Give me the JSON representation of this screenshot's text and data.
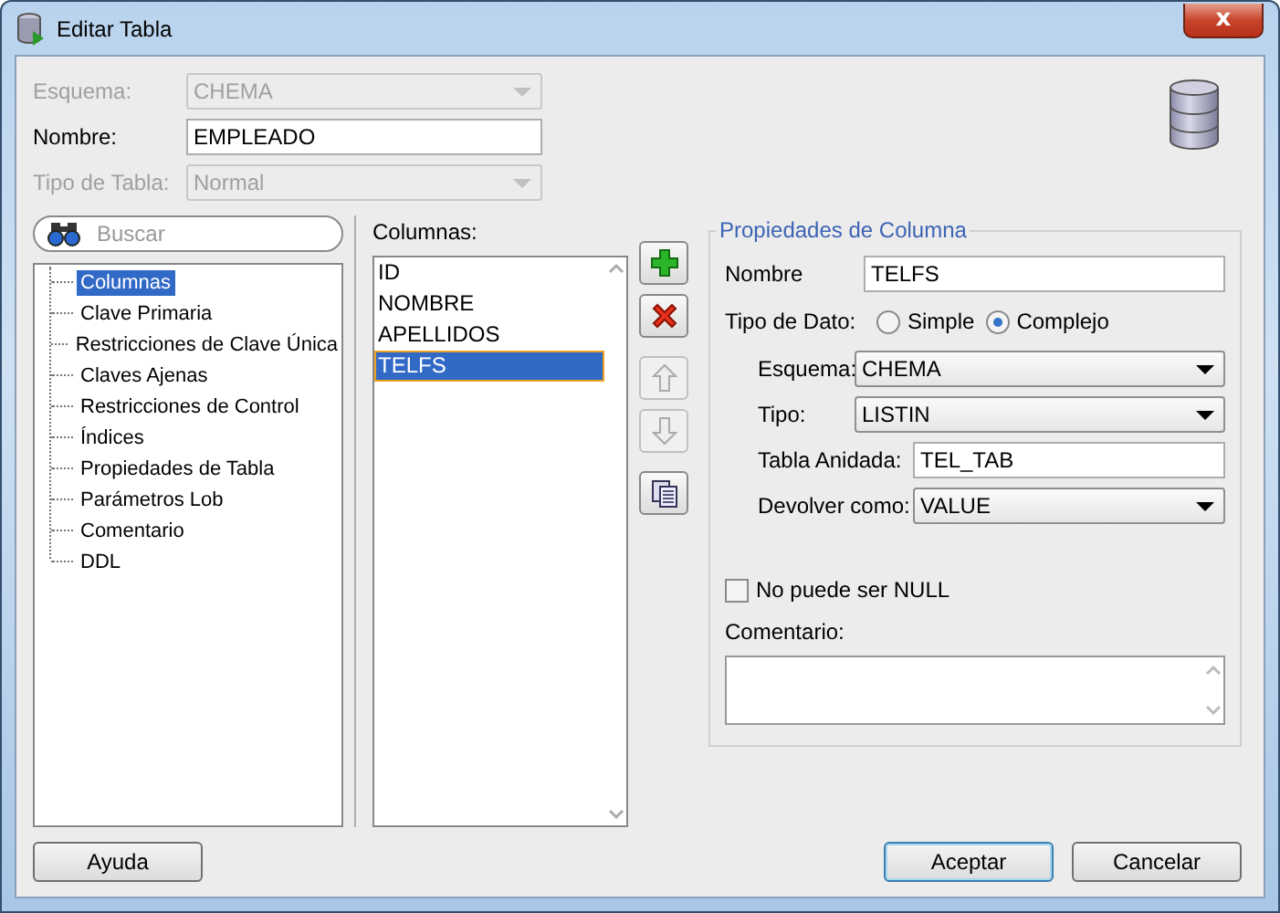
{
  "window": {
    "title": "Editar Tabla",
    "close": "x"
  },
  "header_fields": [
    {
      "label": "Esquema:",
      "kind": "select",
      "value": "CHEMA",
      "disabled": true
    },
    {
      "label": "Nombre:",
      "kind": "text",
      "value": "EMPLEADO",
      "disabled": false
    },
    {
      "label": "Tipo de Tabla:",
      "kind": "select",
      "value": "Normal",
      "disabled": true
    }
  ],
  "search": {
    "placeholder": "Buscar"
  },
  "tree": {
    "items": [
      {
        "label": "Columnas",
        "selected": true
      },
      {
        "label": "Clave Primaria",
        "selected": false
      },
      {
        "label": "Restricciones de Clave Única",
        "selected": false
      },
      {
        "label": "Claves Ajenas",
        "selected": false
      },
      {
        "label": "Restricciones de Control",
        "selected": false
      },
      {
        "label": "Índices",
        "selected": false
      },
      {
        "label": "Propiedades de Tabla",
        "selected": false
      },
      {
        "label": "Parámetros Lob",
        "selected": false
      },
      {
        "label": "Comentario",
        "selected": false
      },
      {
        "label": "DDL",
        "selected": false
      }
    ]
  },
  "columns": {
    "label": "Columnas:",
    "items": [
      {
        "label": "ID",
        "selected": false
      },
      {
        "label": "NOMBRE",
        "selected": false
      },
      {
        "label": "APELLIDOS",
        "selected": false
      },
      {
        "label": "TELFS",
        "selected": true
      }
    ]
  },
  "column_tools": [
    {
      "kind": "add",
      "disabled": false
    },
    {
      "kind": "delete",
      "disabled": false
    },
    {
      "kind": "up",
      "disabled": true
    },
    {
      "kind": "down",
      "disabled": true
    },
    {
      "kind": "copy",
      "disabled": false
    }
  ],
  "properties": {
    "title": "Propiedades de Columna",
    "name": {
      "label": "Nombre",
      "value": "TELFS"
    },
    "data_type": {
      "label": "Tipo de Dato:",
      "options": [
        {
          "label": "Simple",
          "selected": false
        },
        {
          "label": "Complejo",
          "selected": true
        }
      ]
    },
    "fields": [
      {
        "label": "Esquema:",
        "kind": "select",
        "value": "CHEMA"
      },
      {
        "label": "Tipo:",
        "kind": "select",
        "value": "LISTIN"
      },
      {
        "label": "Tabla Anidada:",
        "kind": "text",
        "value": "TEL_TAB"
      },
      {
        "label": "Devolver como:",
        "kind": "select",
        "value": "VALUE"
      }
    ],
    "not_null": {
      "label": "No puede ser NULL",
      "checked": false
    },
    "comment": {
      "label": "Comentario:"
    }
  },
  "buttons": {
    "help": "Ayuda",
    "ok": "Aceptar",
    "cancel": "Cancelar"
  }
}
